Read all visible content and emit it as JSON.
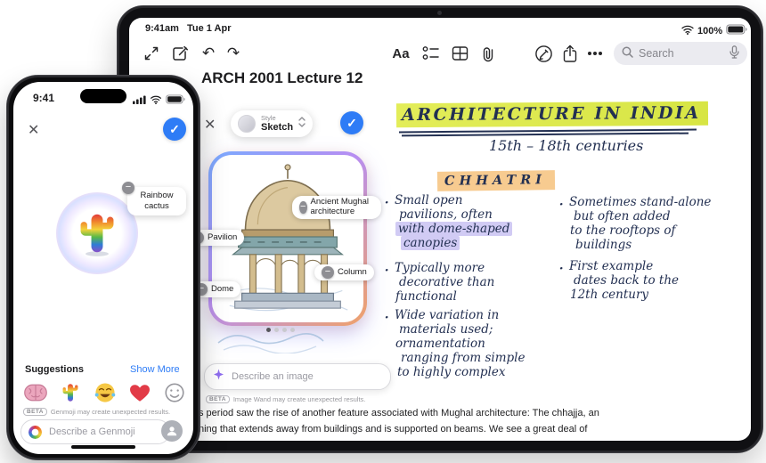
{
  "iphone": {
    "status_time": "9:41",
    "close_glyph": "✕",
    "check_glyph": "✓",
    "minus_glyph": "−",
    "genmoji": {
      "result_tag": "Rainbow cactus",
      "suggestions_label": "Suggestions",
      "show_more_label": "Show More",
      "beta_badge": "BETA",
      "beta_note": "Genmoji may create unexpected results.",
      "input_placeholder": "Describe a Genmoji"
    }
  },
  "ipad": {
    "status_time": "9:41am",
    "status_date": "Tue 1 Apr",
    "battery_percent": "100%",
    "toolbar": {
      "undo_glyph": "↶",
      "redo_glyph": "↷",
      "format_label": "Aa",
      "search_placeholder": "Search"
    },
    "note": {
      "title": "ARCH 2001 Lecture 12",
      "heading": "ARCHITECTURE IN INDIA",
      "subheading": "15th – 18th centuries",
      "section_heading": "CHHATRI",
      "bullets_left": [
        {
          "lines": [
            "Small open",
            "pavilions, often",
            "with dome-shaped",
            "canopies"
          ]
        },
        {
          "lines": [
            "Typically more",
            "decorative than",
            "functional"
          ]
        },
        {
          "lines": [
            "Wide variation in",
            "materials used;",
            "ornamentation",
            "ranging from simple",
            "to highly complex"
          ]
        }
      ],
      "bullets_right": [
        {
          "lines": [
            "Sometimes stand-alone",
            "but often added",
            "to the rooftops of",
            "buildings"
          ]
        },
        {
          "lines": [
            "First example",
            "dates back to the",
            "12th century"
          ]
        }
      ],
      "body_line_1": "s period saw the rise of another feature associated with Mughal architecture: The chhajja, an",
      "body_line_2": "ning that extends away from buildings and is supported on beams. We see a great deal of"
    },
    "image_wand": {
      "close_glyph": "✕",
      "check_glyph": "✓",
      "minus_glyph": "−",
      "style_label": "Style",
      "style_value": "Sketch",
      "tag_mughal": "Ancient Mughal architecture",
      "tag_pavilion": "Pavilion",
      "tag_dome": "Dome",
      "tag_column": "Column",
      "input_placeholder": "Describe an image",
      "beta_badge": "BETA",
      "beta_note": "Image Wand may create unexpected results."
    }
  }
}
